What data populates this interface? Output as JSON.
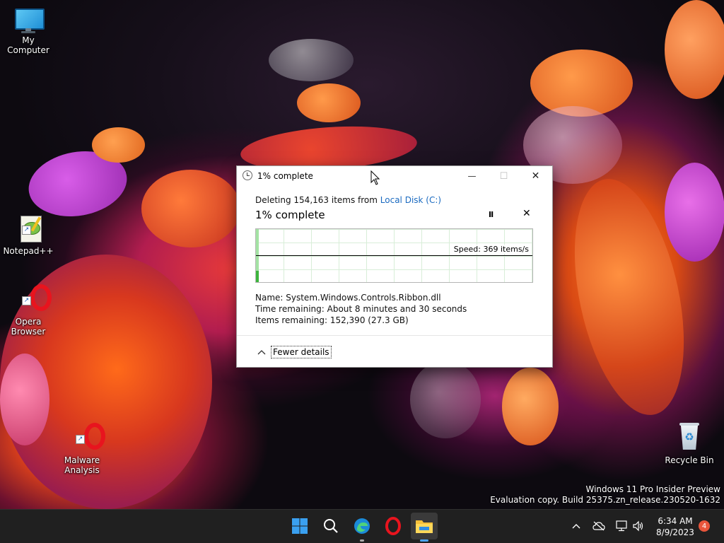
{
  "desktop": {
    "icons": [
      {
        "label": "My Computer"
      },
      {
        "label": "Notepad++"
      },
      {
        "label": "Opera Browser"
      },
      {
        "label": "Malware Analysis"
      },
      {
        "label": "Recycle Bin"
      }
    ]
  },
  "dialog": {
    "title": "1% complete",
    "deleting_prefix": "Deleting 154,163 items from ",
    "deleting_location": "Local Disk (C:)",
    "headline": "1% complete",
    "progress_fraction": 0.01,
    "speed_text": "Speed: 369 items/s",
    "name_line": "Name:  System.Windows.Controls.Ribbon.dll",
    "time_line": "Time remaining:  About 8 minutes and 30 seconds",
    "items_line": "Items remaining:  152,390 (27.3 GB)",
    "fewer_details": "Fewer details",
    "buttons": {
      "minimize": "—",
      "maximize": "☐",
      "close": "✕",
      "pause": "II",
      "cancel": "✕"
    }
  },
  "watermark": {
    "line1": "Windows 11 Pro Insider Preview",
    "line2": "Evaluation copy. Build 25375.zn_release.230520-1632"
  },
  "taskbar": {
    "apps": [
      {
        "icon": "windows-start-icon"
      },
      {
        "icon": "search-icon"
      },
      {
        "icon": "edge-icon"
      },
      {
        "icon": "opera-icon"
      },
      {
        "icon": "file-explorer-icon"
      }
    ],
    "tray": {
      "chevron": "^"
    },
    "time": "6:34 AM",
    "date": "8/9/2023",
    "notification_count": "4"
  }
}
